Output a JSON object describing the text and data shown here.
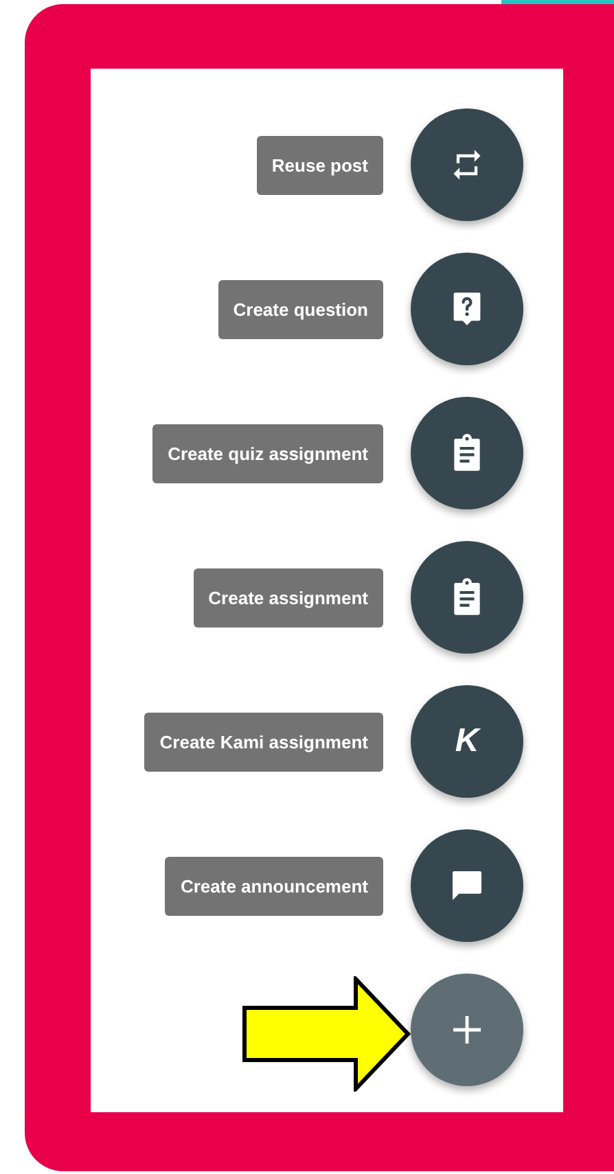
{
  "actions": [
    {
      "label": "Reuse post",
      "kind": "repeat"
    },
    {
      "label": "Create question",
      "kind": "question"
    },
    {
      "label": "Create quiz assignment",
      "kind": "clipboard"
    },
    {
      "label": "Create assignment",
      "kind": "clipboard"
    },
    {
      "label": "Create Kami assignment",
      "kind": "letter",
      "glyph": "K"
    },
    {
      "label": "Create announcement",
      "kind": "chat"
    }
  ],
  "main_button": {
    "kind": "plus"
  },
  "annotation": {
    "kind": "arrow"
  }
}
